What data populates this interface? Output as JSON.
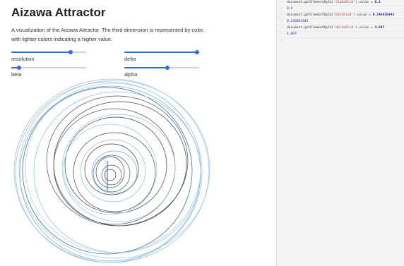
{
  "page": {
    "title": "Aizawa Attractor",
    "description": "A visualization of the Aizawa Attractor. The third dimension is represented by color, with lighter colors indicating a higher value."
  },
  "controls": [
    {
      "label": "resolution",
      "value": 0.79
    },
    {
      "label": "delta",
      "value": 0.97
    },
    {
      "label": "beta",
      "value": 0.1
    },
    {
      "label": "alpha",
      "value": 0.58
    }
  ],
  "console": {
    "entries": [
      {
        "prefix": "›",
        "code_start": "document.getElementById(",
        "id": "'alphaSlid'",
        "code_end": ").value = ",
        "value": "0.2"
      },
      {
        "prefix": "‹",
        "output": "0.2"
      },
      {
        "prefix": "›",
        "code_start": "document.getElementById(",
        "id": "'betaSlid'",
        "code_end": ").value = ",
        "value": "0.246835443"
      },
      {
        "prefix": "‹",
        "output": "0.246835443"
      },
      {
        "prefix": "›",
        "code_start": "document.getElementById(",
        "id": "'deltaSlid'",
        "code_end": ").value = ",
        "value": "4.897"
      },
      {
        "prefix": "‹",
        "output": "4.897"
      }
    ],
    "prompt_symbol": "›"
  },
  "colors": {
    "accent": "#2f6fd6",
    "curve_dark": "#3a3a3a",
    "curve_light": "#8fbcdc"
  }
}
